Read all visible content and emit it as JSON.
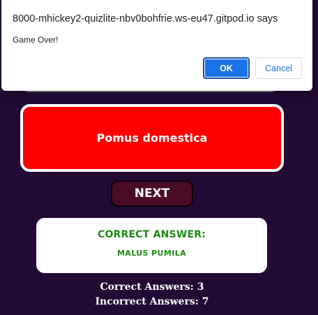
{
  "dialog": {
    "origin": "8000-mhickey2-quizlite-nbv0bohfrie.ws-eu47.gitpod.io says",
    "message": "Game Over!",
    "ok_label": "OK",
    "cancel_label": "Cancel"
  },
  "quiz": {
    "selected_answer": "Pomus domestica",
    "next_label": "NEXT",
    "correct_answer_heading": "CORRECT ANSWER:",
    "correct_answer_value": "MALUS PUMILA",
    "correct_count_text": "Correct Answers: 3",
    "incorrect_count_text": "Incorrect Answers: 7"
  },
  "colors": {
    "page_background": "#220a35",
    "wrong_answer": "#ff0000",
    "correct_text": "#1c8a12",
    "next_button": "#4a0b24",
    "dialog_primary": "#1a73e8"
  }
}
